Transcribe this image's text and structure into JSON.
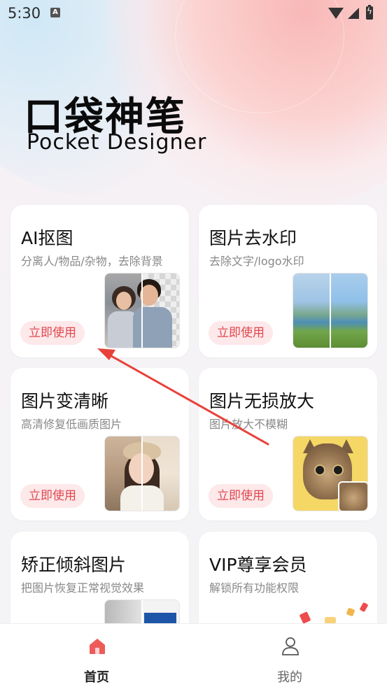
{
  "status_bar": {
    "time": "5:30",
    "notification_icon": "a-icon",
    "icons": [
      "wifi-icon",
      "signal-icon",
      "battery-charging-icon"
    ]
  },
  "brand": {
    "title": "口袋神笔",
    "subtitle": "Pocket  Designer"
  },
  "cards": [
    {
      "title": "AI抠图",
      "description": "分离人/物品/杂物，去除背景",
      "button": "立即使用",
      "thumbnail": "portrait-cutout-before-after"
    },
    {
      "title": "图片去水印",
      "description": "去除文字/logo水印",
      "button": "立即使用",
      "thumbnail": "landscape-before-after"
    },
    {
      "title": "图片变清晰",
      "description": "高清修复低画质图片",
      "button": "立即使用",
      "thumbnail": "portrait-enhance-before-after"
    },
    {
      "title": "图片无损放大",
      "description": "图片放大不模糊",
      "button": "立即使用",
      "thumbnail": "cat-upscale"
    },
    {
      "title": "矫正倾斜图片",
      "description": "把图片恢复正常视觉效果",
      "thumbnail": "document-deskew"
    },
    {
      "title": "VIP尊享会员",
      "description": "解锁所有功能权限",
      "thumbnail": "gift-decoration"
    }
  ],
  "tabbar": {
    "items": [
      {
        "label": "首页",
        "icon": "home-icon",
        "active": true
      },
      {
        "label": "我的",
        "icon": "user-icon",
        "active": false
      }
    ]
  },
  "colors": {
    "accent": "#e0494f",
    "button_bg": "#fde8ea",
    "annotation_arrow": "#e8413a"
  }
}
